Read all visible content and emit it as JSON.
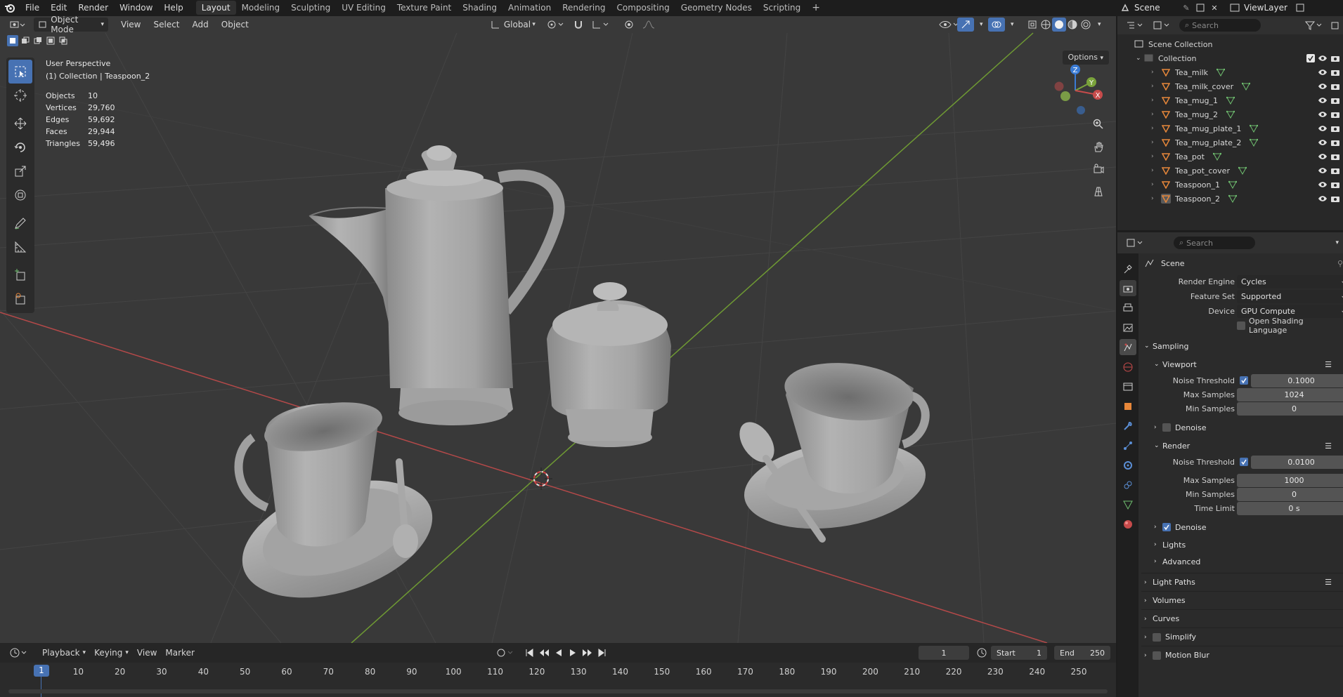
{
  "topbar": {
    "menus": [
      "File",
      "Edit",
      "Render",
      "Window",
      "Help"
    ],
    "workspaces": [
      "Layout",
      "Modeling",
      "Sculpting",
      "UV Editing",
      "Texture Paint",
      "Shading",
      "Animation",
      "Rendering",
      "Compositing",
      "Geometry Nodes",
      "Scripting"
    ],
    "active_workspace": "Layout",
    "scene": "Scene",
    "view_layer": "ViewLayer"
  },
  "viewport_header": {
    "mode": "Object Mode",
    "menus": [
      "View",
      "Select",
      "Add",
      "Object"
    ],
    "orientation": "Global",
    "options": "Options"
  },
  "viewport": {
    "perspective": "User Perspective",
    "context": "(1) Collection | Teaspoon_2",
    "stats": [
      {
        "label": "Objects",
        "value": "10"
      },
      {
        "label": "Vertices",
        "value": "29,760"
      },
      {
        "label": "Edges",
        "value": "59,692"
      },
      {
        "label": "Faces",
        "value": "29,944"
      },
      {
        "label": "Triangles",
        "value": "59,496"
      }
    ],
    "gizmo_axes": [
      "Z",
      "Y",
      "X"
    ]
  },
  "timeline": {
    "menus": [
      "Playback",
      "Keying",
      "View",
      "Marker"
    ],
    "current_frame": "1",
    "start_label": "Start",
    "start": "1",
    "end_label": "End",
    "end": "250",
    "ticks": [
      "1",
      "10",
      "20",
      "30",
      "40",
      "50",
      "60",
      "70",
      "80",
      "90",
      "100",
      "110",
      "120",
      "130",
      "140",
      "150",
      "160",
      "170",
      "180",
      "190",
      "200",
      "210",
      "220",
      "230",
      "240",
      "250"
    ]
  },
  "outliner": {
    "search_placeholder": "Search",
    "scene_collection": "Scene Collection",
    "collection": "Collection",
    "items": [
      "Tea_milk",
      "Tea_milk_cover",
      "Tea_mug_1",
      "Tea_mug_2",
      "Tea_mug_plate_1",
      "Tea_mug_plate_2",
      "Tea_pot",
      "Tea_pot_cover",
      "Teaspoon_1",
      "Teaspoon_2"
    ],
    "selected": "Teaspoon_2"
  },
  "properties": {
    "search_placeholder": "Search",
    "context": "Scene",
    "render_engine_label": "Render Engine",
    "render_engine": "Cycles",
    "feature_set_label": "Feature Set",
    "feature_set": "Supported",
    "device_label": "Device",
    "device": "GPU Compute",
    "osl_label": "Open Shading Language",
    "sampling": "Sampling",
    "viewport": "Viewport",
    "vp_noise_label": "Noise Threshold",
    "vp_noise": "0.1000",
    "vp_max_label": "Max Samples",
    "vp_max": "1024",
    "vp_min_label": "Min Samples",
    "vp_min": "0",
    "vp_denoise": "Denoise",
    "render": "Render",
    "r_noise_label": "Noise Threshold",
    "r_noise": "0.0100",
    "r_max_label": "Max Samples",
    "r_max": "1000",
    "r_min_label": "Min Samples",
    "r_min": "0",
    "r_time_label": "Time Limit",
    "r_time": "0 s",
    "r_denoise": "Denoise",
    "lights": "Lights",
    "advanced": "Advanced",
    "light_paths": "Light Paths",
    "volumes": "Volumes",
    "curves": "Curves",
    "simplify": "Simplify",
    "motion_blur": "Motion Blur"
  },
  "colors": {
    "accent": "#4772b3",
    "x_axis": "#c74b4b",
    "y_axis": "#7aa33b",
    "z_axis": "#3a7bd5",
    "object_orange": "#e7873a",
    "mesh_green": "#6fbf6f"
  }
}
